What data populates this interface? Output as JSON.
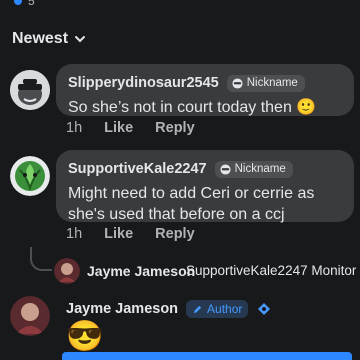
{
  "reactions": {
    "count": "5"
  },
  "sort": {
    "label": "Newest"
  },
  "comments": [
    {
      "author": "Slipperydinosaur2545",
      "badge": "Nickname",
      "text": "So she’s not in court today then 🙂",
      "time": "1h",
      "like": "Like",
      "reply": "Reply"
    },
    {
      "author": "SupportiveKale2247",
      "badge": "Nickname",
      "text": "Might need to add Ceri or cerrie as she's used that before on a ccj",
      "time": "1h",
      "like": "Like",
      "reply": "Reply"
    }
  ],
  "reply_preview": {
    "author": "Jayme Jameson",
    "snippet": "SupportiveKale2247 Monitor..."
  },
  "author_comment": {
    "author": "Jayme Jameson",
    "badge": "Author",
    "emoji": "😎"
  },
  "colors": {
    "accent": "#2d88ff",
    "bubble": "#3a3b3c",
    "background": "#18191a"
  }
}
